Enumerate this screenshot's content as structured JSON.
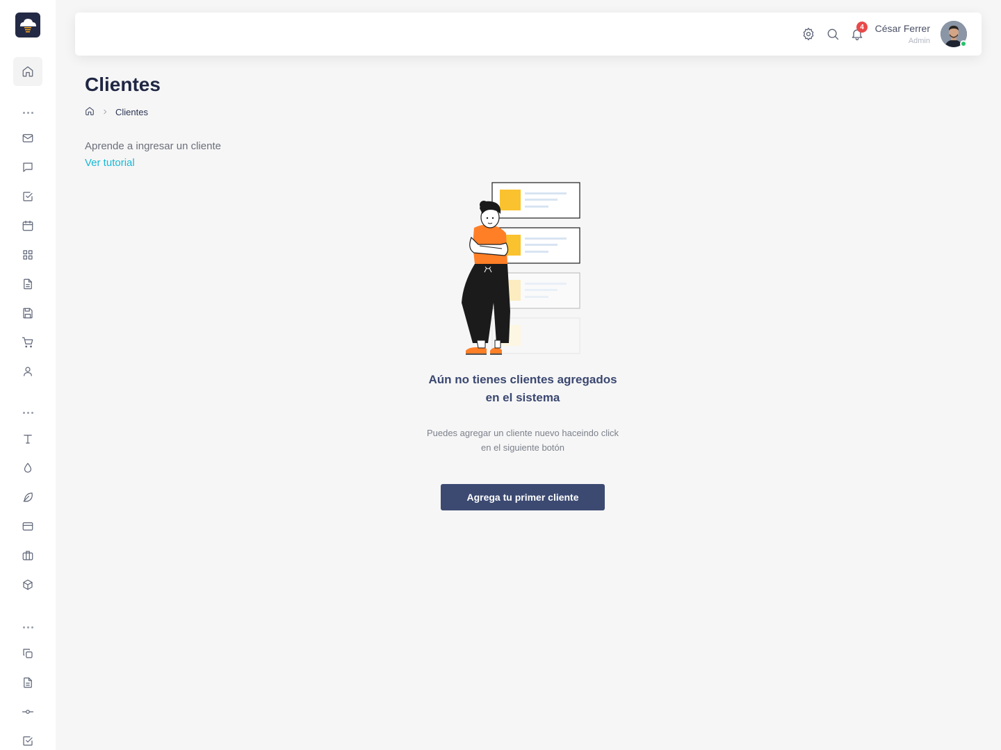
{
  "header": {
    "user_name": "César Ferrer",
    "user_role": "Admin",
    "notification_count": "4",
    "icons": [
      "settings-icon",
      "search-icon",
      "bell-icon"
    ]
  },
  "sidebar": {
    "items": [
      {
        "icon": "home-icon",
        "active": true
      },
      {
        "icon": "mail-icon"
      },
      {
        "icon": "chat-icon"
      },
      {
        "icon": "checkbox-icon"
      },
      {
        "icon": "calendar-icon"
      },
      {
        "icon": "grid-icon"
      },
      {
        "icon": "document-icon"
      },
      {
        "icon": "save-icon"
      },
      {
        "icon": "cart-icon"
      },
      {
        "icon": "user-icon"
      },
      {
        "icon": "text-icon"
      },
      {
        "icon": "drop-icon"
      },
      {
        "icon": "feather-icon"
      },
      {
        "icon": "credit-card-icon"
      },
      {
        "icon": "briefcase-icon"
      },
      {
        "icon": "box-icon"
      },
      {
        "icon": "copy-icon"
      },
      {
        "icon": "file-text-icon"
      },
      {
        "icon": "commit-icon"
      },
      {
        "icon": "check-square-icon"
      }
    ]
  },
  "page": {
    "title": "Clientes",
    "breadcrumb": [
      "Clientes"
    ],
    "learn_text": "Aprende a ingresar un cliente",
    "tutorial_link": "Ver tutorial"
  },
  "empty_state": {
    "title_line1": "Aún no tienes clientes agregados",
    "title_line2": "en el sistema",
    "desc_line1": "Puedes agregar un cliente nuevo haceindo click",
    "desc_line2": "en el siguiente botón",
    "button_label": "Agrega tu primer cliente"
  },
  "colors": {
    "accent": "#3c4a72",
    "link": "#16b8d6",
    "badge": "#e84a4a",
    "online": "#27c26c",
    "background": "#f6f6f6"
  }
}
